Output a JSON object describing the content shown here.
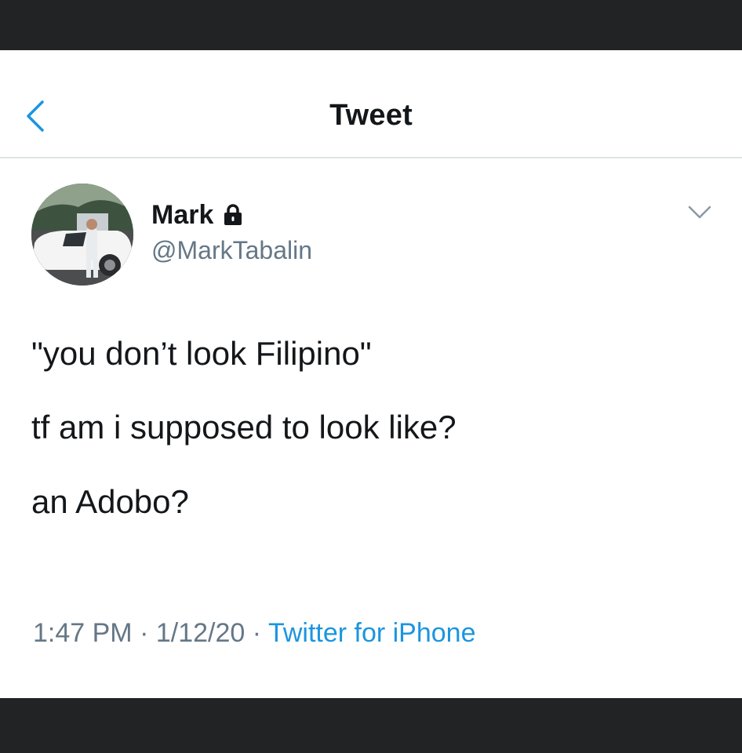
{
  "header": {
    "title": "Tweet",
    "back_icon": "chevron-left-icon"
  },
  "tweet": {
    "author_name": "Mark",
    "protected_icon": "lock-icon",
    "author_handle": "@MarkTabalin",
    "menu_icon": "chevron-down-icon",
    "lines": [
      "\"you don’t look Filipino\"",
      "tf am i supposed to look like?",
      "an Adobo?"
    ],
    "time": "1:47 PM",
    "date": "1/12/20",
    "separator": "·",
    "source": "Twitter for iPhone"
  },
  "colors": {
    "accent": "#1b95e0",
    "text_primary": "#14171a",
    "text_secondary": "#657786",
    "divider": "#dfe3e6",
    "frame": "#222325"
  }
}
